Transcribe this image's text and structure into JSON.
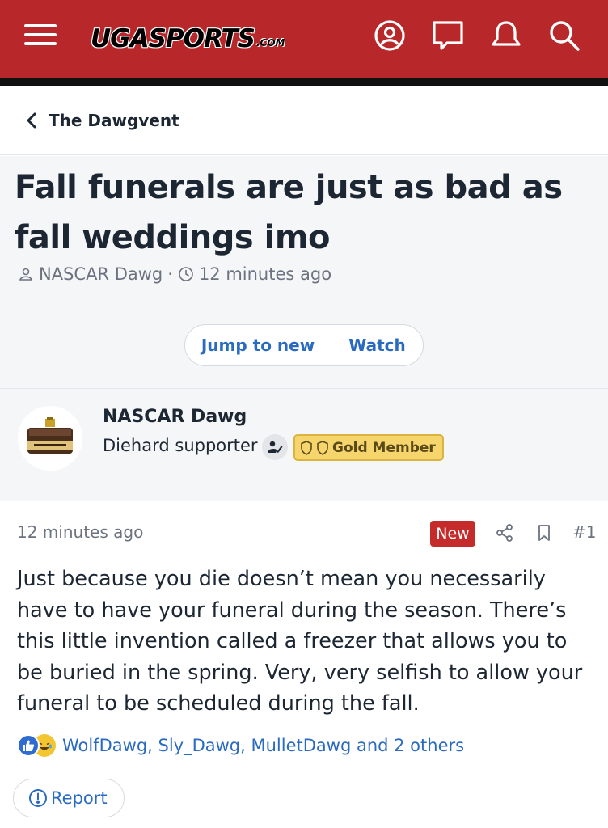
{
  "header": {
    "logo_main": "UGASPORTS",
    "logo_sub": ".COM",
    "bg_color": "#b8282b"
  },
  "breadcrumb": {
    "label": "The Dawgvent"
  },
  "thread": {
    "title": "Fall funerals are just as bad as fall weddings imo",
    "author": "NASCAR Dawg",
    "separator": "·",
    "time": "12 minutes ago",
    "jump_label": "Jump to new",
    "watch_label": "Watch"
  },
  "author_block": {
    "name": "NASCAR Dawg",
    "title": "Diehard supporter",
    "badge": "Gold Member"
  },
  "post": {
    "time": "12 minutes ago",
    "new_label": "New",
    "number": "#1",
    "body": "Just because you die doesn’t mean you necessarily have to have your funeral during the season. There’s this little invention called a freezer that allows you to be buried in the spring. Very, very selfish to allow your funeral to be scheduled during the fall.",
    "reactions_text": "WolfDawg, Sly_Dawg, MulletDawg and 2 others",
    "report_label": "Report"
  },
  "colors": {
    "accent": "#2a6bbf",
    "new_badge": "#c62b2b",
    "gold_badge": "#f6d66c"
  }
}
